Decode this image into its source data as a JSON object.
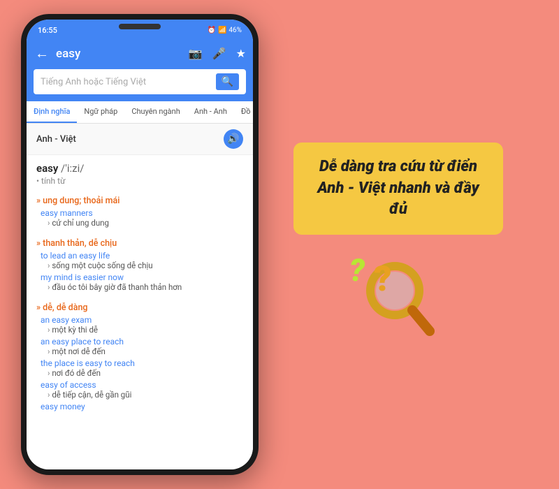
{
  "background_color": "#f48b7d",
  "phone": {
    "status_bar": {
      "time": "16:55",
      "battery": "46%",
      "icons": "alarm wifi signal"
    },
    "toolbar": {
      "back_label": "←",
      "search_word": "easy",
      "icon_camera": "📷",
      "icon_mic": "🎤",
      "icon_star": "★"
    },
    "search_input": {
      "placeholder": "Tiếng Anh hoặc Tiếng Việt",
      "search_icon": "🔍"
    },
    "tabs": [
      {
        "label": "Định nghĩa",
        "active": true
      },
      {
        "label": "Ngữ pháp",
        "active": false
      },
      {
        "label": "Chuyên ngành",
        "active": false
      },
      {
        "label": "Anh - Anh",
        "active": false
      },
      {
        "label": "Đồ",
        "active": false
      }
    ],
    "dict_header": {
      "lang": "Anh - Việt",
      "speaker_icon": "🔊"
    },
    "word_entry": {
      "word": "easy",
      "phonetic": "/'i:zi/",
      "pos": "tính từ"
    },
    "senses": [
      {
        "heading": "» ung dung; thoải mái",
        "examples": [
          {
            "en": "easy manners",
            "vn": "cử chỉ ung dung"
          }
        ]
      },
      {
        "heading": "» thanh thản, dễ chịu",
        "examples": [
          {
            "en": "to lead an easy life",
            "vn": "sống một cuộc sống dễ chịu"
          },
          {
            "en": "my mind is easier now",
            "vn": "đầu óc tôi bây giờ đã thanh thản hơn"
          }
        ]
      },
      {
        "heading": "» dễ, dễ dàng",
        "examples": [
          {
            "en": "an easy exam",
            "vn": "một kỳ thi dễ"
          },
          {
            "en": "an easy place to reach",
            "vn": "một nơi dễ đến"
          },
          {
            "en": "the place is easy to reach",
            "vn": "nơi đó dễ đến"
          },
          {
            "en": "easy of access",
            "vn": "dễ tiếp cận, dễ gần gũi"
          },
          {
            "en": "easy money",
            "vn": ""
          }
        ]
      }
    ]
  },
  "right_panel": {
    "promo_text": "Dễ dàng tra cứu từ điển Anh - Việt nhanh và đầy đủ",
    "question_green": "?",
    "question_orange": "?"
  }
}
